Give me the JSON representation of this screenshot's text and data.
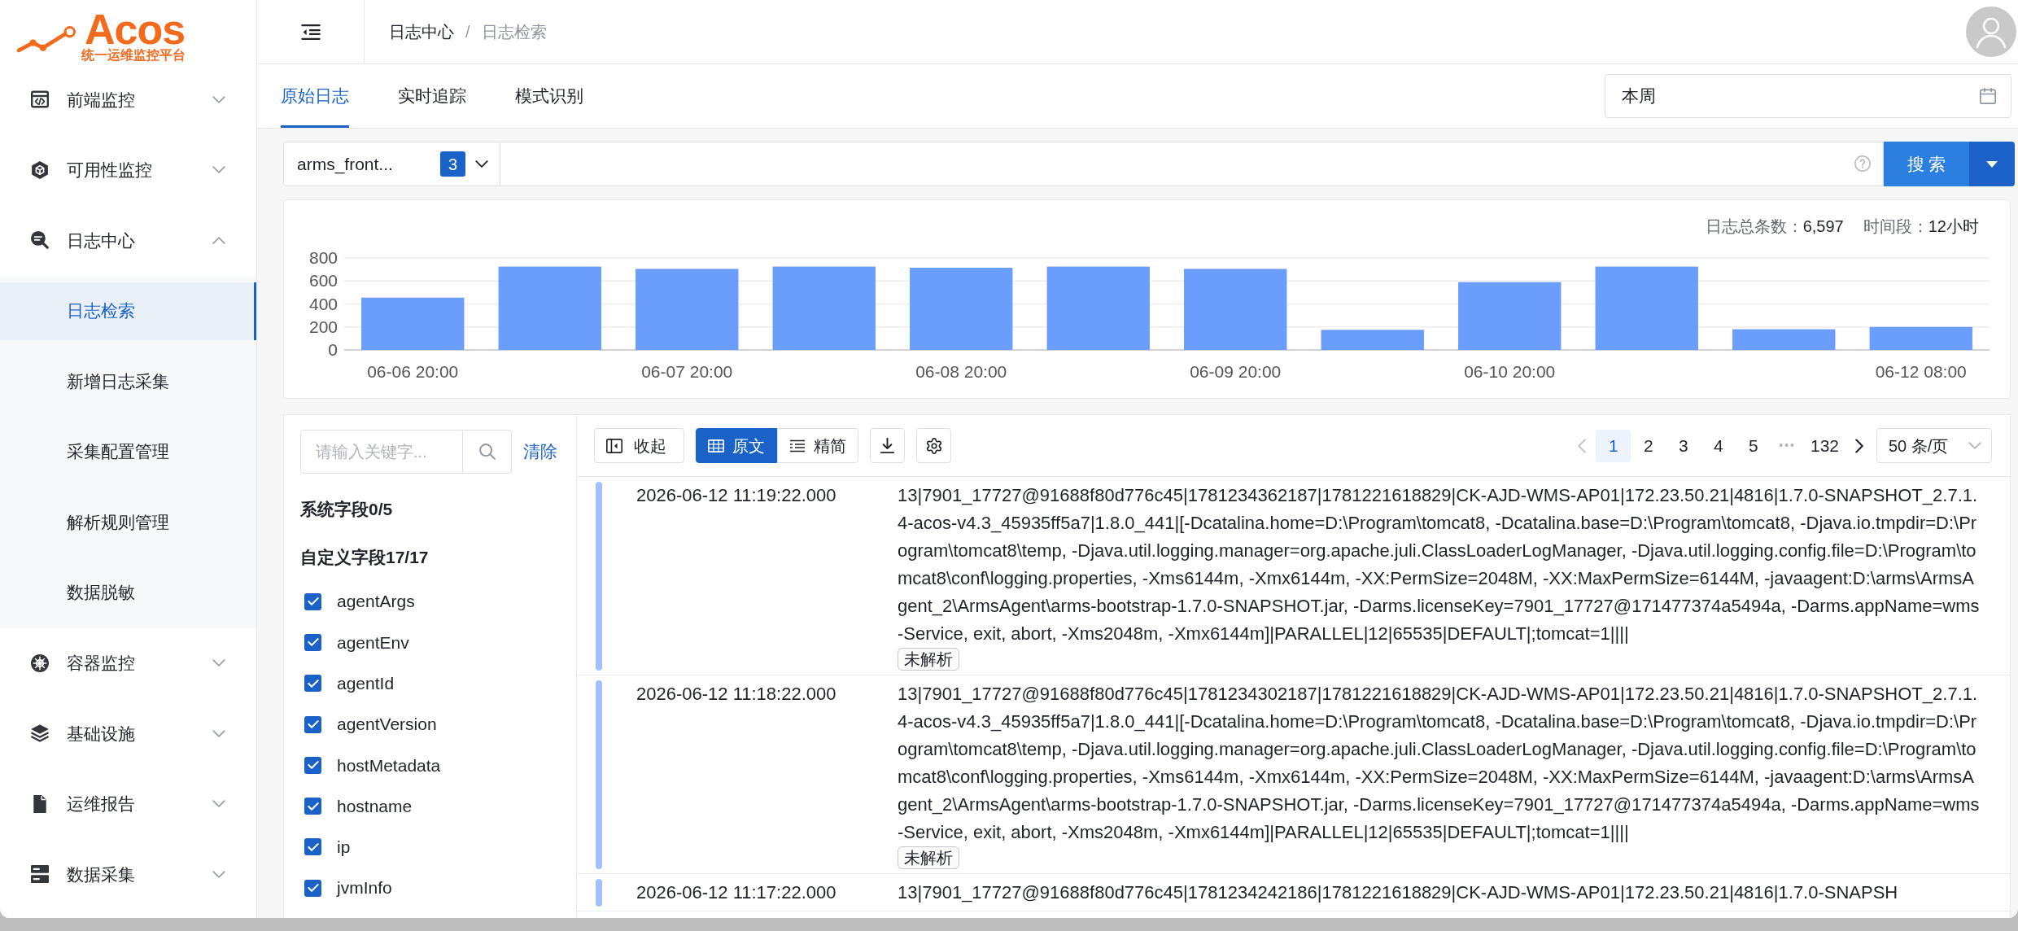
{
  "logo": {
    "name": "Acos",
    "tagline": "统一运维监控平台"
  },
  "sidebar": {
    "items": [
      {
        "label": "前端监控",
        "expanded": false
      },
      {
        "label": "可用性监控",
        "expanded": false
      },
      {
        "label": "日志中心",
        "expanded": true,
        "children": [
          {
            "label": "日志检索",
            "selected": true
          },
          {
            "label": "新增日志采集",
            "selected": false
          },
          {
            "label": "采集配置管理",
            "selected": false
          },
          {
            "label": "解析规则管理",
            "selected": false
          },
          {
            "label": "数据脱敏",
            "selected": false
          }
        ]
      },
      {
        "label": "容器监控",
        "expanded": false
      },
      {
        "label": "基础设施",
        "expanded": false
      },
      {
        "label": "运维报告",
        "expanded": false
      },
      {
        "label": "数据采集",
        "expanded": false
      }
    ]
  },
  "header": {
    "breadcrumb": [
      {
        "label": "日志中心",
        "current": false
      },
      {
        "label": "日志检索",
        "current": true
      }
    ],
    "separator": "/"
  },
  "tabs": [
    {
      "label": "原始日志",
      "selected": true
    },
    {
      "label": "实时追踪",
      "selected": false
    },
    {
      "label": "模式识别",
      "selected": false
    }
  ],
  "date_range": {
    "value": "本周"
  },
  "query_bar": {
    "source": {
      "value": "arms_front...",
      "count": "3"
    },
    "search_button": "搜 索"
  },
  "histogram": {
    "summary": [
      {
        "label": "日志总条数：",
        "value": "6,597"
      },
      {
        "label": "时间段：",
        "value": "12小时"
      }
    ],
    "chart_data": {
      "type": "bar",
      "categories": [
        "06-06 20:00",
        null,
        "06-07 20:00",
        null,
        "06-08 20:00",
        null,
        "06-09 20:00",
        null,
        "06-10 20:00",
        null,
        null,
        "06-12 08:00"
      ],
      "values": [
        455,
        725,
        705,
        725,
        715,
        725,
        705,
        175,
        590,
        725,
        180,
        200
      ],
      "ylim": [
        0,
        800
      ],
      "yticks": [
        0,
        200,
        400,
        600,
        800
      ],
      "grid": true
    }
  },
  "field_panel": {
    "search": {
      "placeholder": "请输入关键字..."
    },
    "clear_link": "清除",
    "groups": [
      {
        "title": "系统字段0/5"
      },
      {
        "title": "自定义字段17/17",
        "fields": [
          {
            "label": "agentArgs",
            "checked": true
          },
          {
            "label": "agentEnv",
            "checked": true
          },
          {
            "label": "agentId",
            "checked": true
          },
          {
            "label": "agentVersion",
            "checked": true
          },
          {
            "label": "hostMetadata",
            "checked": true
          },
          {
            "label": "hostname",
            "checked": true
          },
          {
            "label": "ip",
            "checked": true
          },
          {
            "label": "jvmInfo",
            "checked": true
          }
        ]
      }
    ]
  },
  "toolbar": {
    "collapse_button": "收起",
    "view_modes": [
      {
        "label": "原文",
        "selected": true
      },
      {
        "label": "精简",
        "selected": false
      }
    ],
    "pagination": {
      "previous": {
        "disabled": true
      },
      "pages": [
        {
          "kind": "page",
          "label": "1",
          "selected": true
        },
        {
          "kind": "page",
          "label": "2",
          "selected": false
        },
        {
          "kind": "page",
          "label": "3",
          "selected": false
        },
        {
          "kind": "page",
          "label": "4",
          "selected": false
        },
        {
          "kind": "page",
          "label": "5",
          "selected": false
        },
        {
          "kind": "ellipsis",
          "label": "•••",
          "selected": false
        },
        {
          "kind": "page",
          "label": "132",
          "selected": false
        }
      ],
      "next": {
        "disabled": false
      },
      "page_size": "50 条/页"
    }
  },
  "logs": [
    {
      "time": "2026-06-12 11:19:22.000",
      "message": "13|7901_17727@91688f80d776c45|1781234362187|1781221618829|CK-AJD-WMS-AP01|172.23.50.21|4816|1.7.0-SNAPSHOT_2.7.1.4-acos-v4.3_45935ff5a7|1.8.0_441|[-Dcatalina.home=D:\\Program\\tomcat8, -Dcatalina.base=D:\\Program\\tomcat8, -Djava.io.tmpdir=D:\\Program\\tomcat8\\temp, -Djava.util.logging.manager=org.apache.juli.ClassLoaderLogManager, -Djava.util.logging.config.file=D:\\Program\\tomcat8\\conf\\logging.properties, -Xms6144m, -Xmx6144m, -XX:PermSize=2048M, -XX:MaxPermSize=6144M, -javaagent:D:\\arms\\ArmsAgent_2\\ArmsAgent\\arms-bootstrap-1.7.0-SNAPSHOT.jar, -Darms.licenseKey=7901_17727@171477374a5494a, -Darms.appName=wms-Service, exit, abort, -Xms2048m, -Xmx6144m]|PARALLEL|12|65535|DEFAULT|;tomcat=1||||",
      "tag": "未解析"
    },
    {
      "time": "2026-06-12 11:18:22.000",
      "message": "13|7901_17727@91688f80d776c45|1781234302187|1781221618829|CK-AJD-WMS-AP01|172.23.50.21|4816|1.7.0-SNAPSHOT_2.7.1.4-acos-v4.3_45935ff5a7|1.8.0_441|[-Dcatalina.home=D:\\Program\\tomcat8, -Dcatalina.base=D:\\Program\\tomcat8, -Djava.io.tmpdir=D:\\Program\\tomcat8\\temp, -Djava.util.logging.manager=org.apache.juli.ClassLoaderLogManager, -Djava.util.logging.config.file=D:\\Program\\tomcat8\\conf\\logging.properties, -Xms6144m, -Xmx6144m, -XX:PermSize=2048M, -XX:MaxPermSize=6144M, -javaagent:D:\\arms\\ArmsAgent_2\\ArmsAgent\\arms-bootstrap-1.7.0-SNAPSHOT.jar, -Darms.licenseKey=7901_17727@171477374a5494a, -Darms.appName=wms-Service, exit, abort, -Xms2048m, -Xmx6144m]|PARALLEL|12|65535|DEFAULT|;tomcat=1||||",
      "tag": "未解析"
    },
    {
      "time": "2026-06-12 11:17:22.000",
      "message": "13|7901_17727@91688f80d776c45|1781234242186|1781221618829|CK-AJD-WMS-AP01|172.23.50.21|4816|1.7.0-SNAPSH"
    }
  ]
}
